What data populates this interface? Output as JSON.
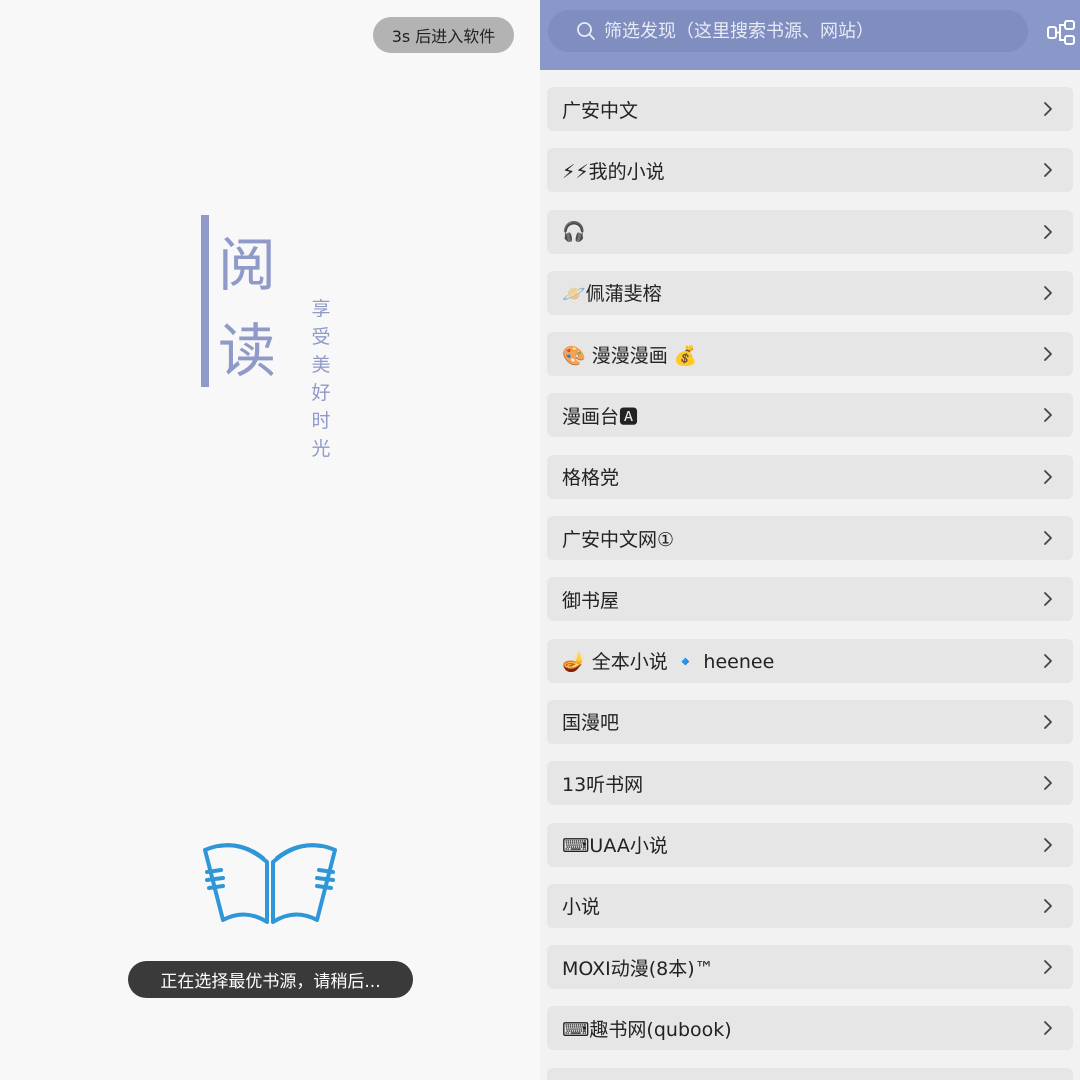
{
  "splash": {
    "skip_label": "3s 后进入软件",
    "title_chars": [
      "阅",
      "读"
    ],
    "slogan_chars": [
      "享",
      "受",
      "美",
      "好",
      "时",
      "光"
    ],
    "toast": "正在选择最优书源，请稍后...",
    "logo_icon": "open-book-icon",
    "accent": "#8f9ac8",
    "logo_color": "#2f97d8"
  },
  "discover": {
    "search": {
      "placeholder": "筛选发现（这里搜索书源、网站）",
      "value": ""
    },
    "icons": {
      "search": "search-icon",
      "group": "group-tree-icon",
      "row_arrow": "chevron-right-icon"
    },
    "header_color": "#8a97c9",
    "items": [
      {
        "label": "广安中文"
      },
      {
        "label": "⚡⚡我的小说"
      },
      {
        "label": "🎧"
      },
      {
        "label": "🪐佩蒲斐榕"
      },
      {
        "label": "🎨 漫漫漫画 💰"
      },
      {
        "label": "漫画台🅰"
      },
      {
        "label": "格格党"
      },
      {
        "label": "广安中文网①"
      },
      {
        "label": "御书屋"
      },
      {
        "label": "🪔 全本小说 🔹 heenee"
      },
      {
        "label": "国漫吧"
      },
      {
        "label": "13听书网"
      },
      {
        "label": "⌨UAA小说"
      },
      {
        "label": "小说"
      },
      {
        "label": "MOXI动漫(8本)™"
      },
      {
        "label": "⌨趣书网(qubook)"
      },
      {
        "label": ""
      }
    ]
  }
}
